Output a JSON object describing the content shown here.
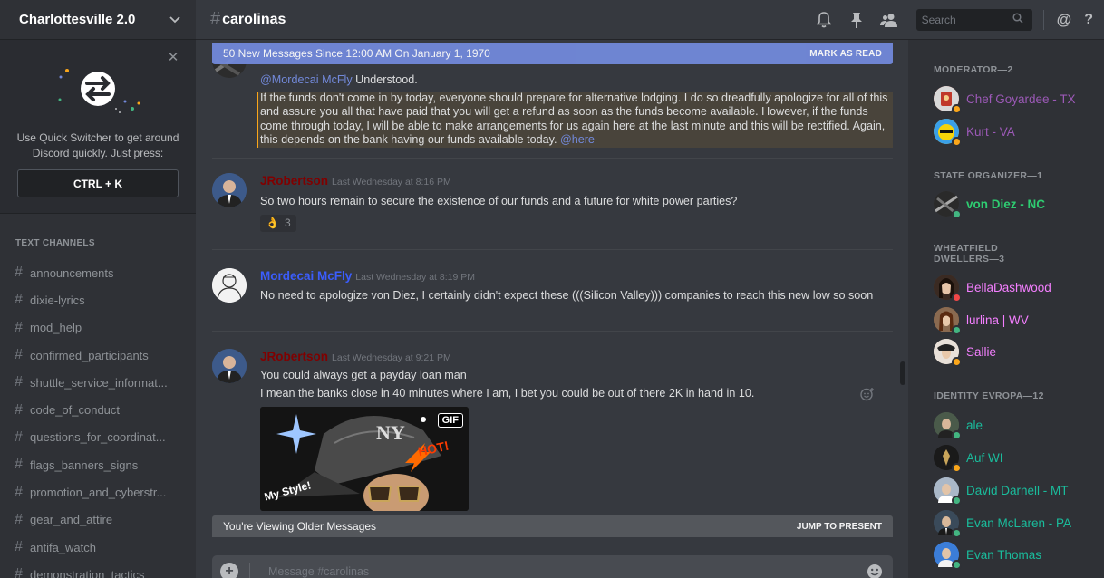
{
  "server": {
    "name": "Charlottesville 2.0"
  },
  "quick_switcher": {
    "text_line1": "Use Quick Switcher to get around",
    "text_line2": "Discord quickly. Just press:",
    "shortcut": "CTRL + K",
    "close_glyph": "✕"
  },
  "channels": {
    "category": "TEXT CHANNELS",
    "hash_glyph": "#",
    "items": [
      "announcements",
      "dixie-lyrics",
      "mod_help",
      "confirmed_participants",
      "shuttle_service_informat...",
      "code_of_conduct",
      "questions_for_coordinat...",
      "flags_banners_signs",
      "promotion_and_cyberstr...",
      "gear_and_attire",
      "antifa_watch",
      "demonstration_tactics"
    ]
  },
  "topbar": {
    "hash": "#",
    "channel": "carolinas",
    "search_placeholder": "Search",
    "at_glyph": "@",
    "help_glyph": "?",
    "icons": [
      "bell-icon",
      "pin-icon",
      "members-icon",
      "search-icon",
      "mention-icon",
      "help-icon"
    ]
  },
  "banner": {
    "text": "50 New Messages Since 12:00 AM On January 1, 1970",
    "action": "MARK AS READ"
  },
  "messages": {
    "m0": {
      "mention": "@Mordecai McFly",
      "text": " Understood.",
      "highlighted": "If the funds don't come in by today, everyone should prepare for alternative lodging. I do so dreadfully apologize for all of this and assure you all that have paid that you will get a refund as soon as the funds become available. However, if the funds come through today, I will be able to make arrangements for us again here at the last minute and this will be rectified. Again, this depends on the bank having our funds available today. ",
      "highlight_mention": "@here"
    },
    "m1": {
      "author": "JRobertson",
      "author_color": "#800000",
      "time": "Last Wednesday at 8:16 PM",
      "text": "So two hours remain to secure the existence of our funds and a future for white power parties?",
      "reaction_emoji": "👌",
      "reaction_count": "3"
    },
    "m2": {
      "author": "Mordecai McFly",
      "author_color": "#3b5dfb",
      "time": "Last Wednesday at 8:19 PM",
      "text": "No need to apologize von Diez, I certainly didn't expect these (((Silicon Valley))) companies to reach this new low so soon"
    },
    "m3": {
      "author": "JRobertson",
      "author_color": "#800000",
      "time": "Last Wednesday at 9:21 PM",
      "line1": "You could always get a payday loan man",
      "line2": "I mean the banks close in 40 minutes where I am, I bet you could be out of there 2K in hand in 10.",
      "gif_tag": "GIF",
      "gif_caption1": "HOT!",
      "gif_caption2": "My Style!"
    }
  },
  "older_bar": {
    "text": "You're Viewing Older Messages",
    "action": "JUMP TO PRESENT"
  },
  "composer": {
    "placeholder": "Message #carolinas",
    "plus_glyph": "+"
  },
  "members": {
    "roles": [
      {
        "title": "MODERATOR—2"
      },
      {
        "title": "STATE ORGANIZER—1"
      },
      {
        "title_line1": "WHEATFIELD",
        "title_line2": "DWELLERS—3"
      },
      {
        "title": "IDENTITY EVROPA—12"
      }
    ],
    "list": [
      {
        "name": "Chef Goyardee - TX",
        "color": "#9b59b6",
        "status": "#faa61a",
        "avatar_color": "#c0392b"
      },
      {
        "name": "Kurt - VA",
        "color": "#9b59b6",
        "status": "#faa61a",
        "avatar_color": "#f1c40f"
      },
      {
        "name": "von Diez - NC",
        "color": "#2ecc71",
        "status": "#43b581",
        "avatar_color": "#444444"
      },
      {
        "name": "BellaDashwood",
        "color": "#f47fff",
        "status": "#f04747",
        "avatar_color": "#5a3a2a"
      },
      {
        "name": "lurlina | WV",
        "color": "#f47fff",
        "status": "#43b581",
        "avatar_color": "#6b4a3a"
      },
      {
        "name": "Sallie",
        "color": "#f47fff",
        "status": "#faa61a",
        "avatar_color": "#d9c7b4"
      },
      {
        "name": "ale",
        "color": "#1abc9c",
        "status": "#43b581",
        "avatar_color": "#4a5a4a"
      },
      {
        "name": "Auf WI",
        "color": "#1abc9c",
        "status": "#faa61a",
        "avatar_color": "#222222"
      },
      {
        "name": "David Darnell - MT",
        "color": "#1abc9c",
        "status": "#43b581",
        "avatar_color": "#8aa0b8"
      },
      {
        "name": "Evan McLaren - PA",
        "color": "#1abc9c",
        "status": "#43b581",
        "avatar_color": "#3a4a5a"
      },
      {
        "name": "Evan Thomas",
        "color": "#1abc9c",
        "status": "#43b581",
        "avatar_color": "#3b7dd8"
      }
    ]
  },
  "colors": {
    "accent": "#7289da",
    "mention_highlight": "#faa61a",
    "background": "#36393f",
    "sidebar": "#2f3136"
  }
}
